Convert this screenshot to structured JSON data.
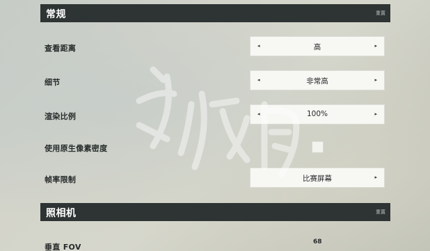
{
  "sections": {
    "general": {
      "title": "常规",
      "reset_label": "重置"
    },
    "camera": {
      "title": "照相机",
      "reset_label": "重置"
    }
  },
  "rows": {
    "view_distance": {
      "label": "查看距离",
      "value": "高"
    },
    "detail": {
      "label": "细节",
      "value": "非常高"
    },
    "render_scale": {
      "label": "渲染比例",
      "value": "100%"
    },
    "native_pixel_density": {
      "label": "使用原生像素密度",
      "checked": false
    },
    "frame_rate_limit": {
      "label": "帧率限制",
      "value": "比赛屏幕"
    },
    "vertical_fov": {
      "label": "垂直 FOV",
      "value": "68"
    }
  },
  "icons": {
    "prev": "arrow-left-icon",
    "next": "arrow-right-icon"
  },
  "colors": {
    "header_bg": "#2e3433",
    "selector_bg": "#f7f7f4"
  }
}
